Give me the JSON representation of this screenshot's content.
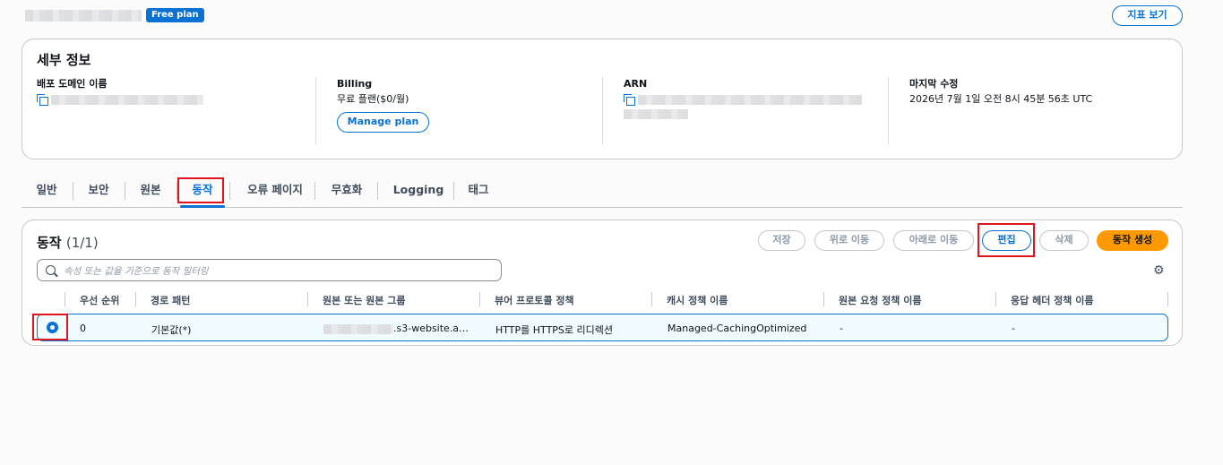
{
  "header": {
    "plan_badge": "Free plan",
    "metrics_button": "지표 보기"
  },
  "details": {
    "title": "세부 정보",
    "domain_label": "배포 도메인 이름",
    "billing_label": "Billing",
    "billing_value": "무료 플랜($0/월)",
    "manage_plan": "Manage plan",
    "arn_label": "ARN",
    "modified_label": "마지막 수정",
    "modified_value": "2026년 7월 1일 오전 8시 45분 56초 UTC"
  },
  "tabs": [
    "일반",
    "보안",
    "원본",
    "동작",
    "오류 페이지",
    "무효화",
    "Logging",
    "태그"
  ],
  "active_tab": "동작",
  "behaviors": {
    "title": "동작",
    "count": "(1/1)",
    "buttons": {
      "save": "저장",
      "move_up": "위로 이동",
      "move_down": "아래로 이동",
      "edit": "편집",
      "delete": "삭제",
      "create": "동작 생성"
    },
    "filter_placeholder": "속성 또는 값을 기준으로 동작 필터링",
    "columns": [
      "우선 순위",
      "경로 패턴",
      "원본 또는 원본 그룹",
      "뷰어 프로토콜 정책",
      "캐시 정책 이름",
      "원본 요청 정책 이름",
      "응답 헤더 정책 이름"
    ],
    "rows": [
      {
        "priority": "0",
        "path": "기본값(*)",
        "origin_suffix": ".s3-website.a…",
        "viewer_policy": "HTTP를 HTTPS로 리디렉션",
        "cache_policy": "Managed-CachingOptimized",
        "origin_request_policy": "-",
        "response_headers_policy": "-"
      }
    ]
  },
  "colors": {
    "accent": "#0972d3",
    "primary_button": "#ff9900",
    "highlight": "#e0141e"
  }
}
